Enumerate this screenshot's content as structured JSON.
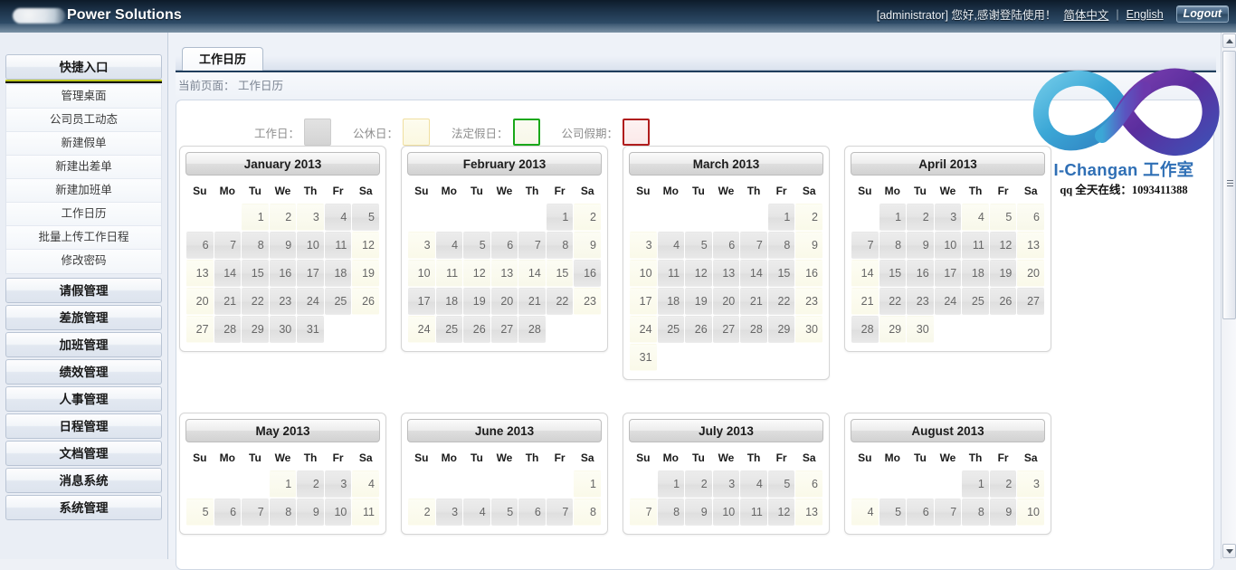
{
  "header": {
    "brand": "Power Solutions",
    "greeting": "[administrator] 您好,感谢登陆使用！",
    "lang_zh": "简体中文",
    "lang_sep": "|",
    "lang_en": "English",
    "logout": "Logout"
  },
  "sidebar": {
    "quick_title": "快捷入口",
    "quick_items": [
      {
        "label": "管理桌面"
      },
      {
        "label": "公司员工动态"
      },
      {
        "label": "新建假单"
      },
      {
        "label": "新建出差单"
      },
      {
        "label": "新建加班单"
      },
      {
        "label": "工作日历"
      },
      {
        "label": "批量上传工作日程"
      },
      {
        "label": "修改密码"
      }
    ],
    "sections": [
      {
        "label": "请假管理"
      },
      {
        "label": "差旅管理"
      },
      {
        "label": "加班管理"
      },
      {
        "label": "绩效管理"
      },
      {
        "label": "人事管理"
      },
      {
        "label": "日程管理"
      },
      {
        "label": "文档管理"
      },
      {
        "label": "消息系统"
      },
      {
        "label": "系统管理"
      }
    ]
  },
  "main": {
    "tab_label": "工作日历",
    "breadcrumb": "当前页面： 工作日历"
  },
  "legend": [
    {
      "label": "工作日：",
      "type": "work",
      "color": "#d4d4d4"
    },
    {
      "label": "公休日：",
      "type": "rest",
      "color": "#fbf8e0"
    },
    {
      "label": "法定假日：",
      "type": "legal",
      "color": "#1aa81a"
    },
    {
      "label": "公司假期：",
      "type": "comp",
      "color": "#b01d1d"
    }
  ],
  "watermark": {
    "title": "I-Changan 工作室",
    "subtitle": "qq 全天在线：1093411388"
  },
  "calendar": {
    "weekdays": [
      "Su",
      "Mo",
      "Tu",
      "We",
      "Th",
      "Fr",
      "Sa"
    ],
    "months": [
      {
        "title": "January 2013",
        "lead_blank": 2,
        "days": [
          {
            "n": 1,
            "t": "legal"
          },
          {
            "n": 2,
            "t": "legal"
          },
          {
            "n": 3,
            "t": "legal"
          },
          {
            "n": 4,
            "t": "work"
          },
          {
            "n": 5,
            "t": "work"
          },
          {
            "n": 6,
            "t": "work"
          },
          {
            "n": 7,
            "t": "work"
          },
          {
            "n": 8,
            "t": "work"
          },
          {
            "n": 9,
            "t": "work"
          },
          {
            "n": 10,
            "t": "work"
          },
          {
            "n": 11,
            "t": "work"
          },
          {
            "n": 12,
            "t": "rest"
          },
          {
            "n": 13,
            "t": "rest"
          },
          {
            "n": 14,
            "t": "work"
          },
          {
            "n": 15,
            "t": "work"
          },
          {
            "n": 16,
            "t": "work"
          },
          {
            "n": 17,
            "t": "work"
          },
          {
            "n": 18,
            "t": "work"
          },
          {
            "n": 19,
            "t": "rest"
          },
          {
            "n": 20,
            "t": "rest"
          },
          {
            "n": 21,
            "t": "work"
          },
          {
            "n": 22,
            "t": "work"
          },
          {
            "n": 23,
            "t": "work"
          },
          {
            "n": 24,
            "t": "work"
          },
          {
            "n": 25,
            "t": "work"
          },
          {
            "n": 26,
            "t": "rest"
          },
          {
            "n": 27,
            "t": "rest"
          },
          {
            "n": 28,
            "t": "work"
          },
          {
            "n": 29,
            "t": "work"
          },
          {
            "n": 30,
            "t": "work"
          },
          {
            "n": 31,
            "t": "work"
          }
        ]
      },
      {
        "title": "February 2013",
        "lead_blank": 5,
        "days": [
          {
            "n": 1,
            "t": "work"
          },
          {
            "n": 2,
            "t": "rest"
          },
          {
            "n": 3,
            "t": "rest"
          },
          {
            "n": 4,
            "t": "work"
          },
          {
            "n": 5,
            "t": "work"
          },
          {
            "n": 6,
            "t": "work"
          },
          {
            "n": 7,
            "t": "work"
          },
          {
            "n": 8,
            "t": "work"
          },
          {
            "n": 9,
            "t": "legal"
          },
          {
            "n": 10,
            "t": "legal"
          },
          {
            "n": 11,
            "t": "legal"
          },
          {
            "n": 12,
            "t": "legal"
          },
          {
            "n": 13,
            "t": "legal"
          },
          {
            "n": 14,
            "t": "legal"
          },
          {
            "n": 15,
            "t": "legal"
          },
          {
            "n": 16,
            "t": "work"
          },
          {
            "n": 17,
            "t": "work"
          },
          {
            "n": 18,
            "t": "work"
          },
          {
            "n": 19,
            "t": "work"
          },
          {
            "n": 20,
            "t": "work"
          },
          {
            "n": 21,
            "t": "work"
          },
          {
            "n": 22,
            "t": "work"
          },
          {
            "n": 23,
            "t": "rest"
          },
          {
            "n": 24,
            "t": "rest"
          },
          {
            "n": 25,
            "t": "work"
          },
          {
            "n": 26,
            "t": "work"
          },
          {
            "n": 27,
            "t": "work"
          },
          {
            "n": 28,
            "t": "work"
          }
        ]
      },
      {
        "title": "March 2013",
        "lead_blank": 5,
        "days": [
          {
            "n": 1,
            "t": "work"
          },
          {
            "n": 2,
            "t": "rest"
          },
          {
            "n": 3,
            "t": "rest"
          },
          {
            "n": 4,
            "t": "work"
          },
          {
            "n": 5,
            "t": "work"
          },
          {
            "n": 6,
            "t": "work"
          },
          {
            "n": 7,
            "t": "work"
          },
          {
            "n": 8,
            "t": "work"
          },
          {
            "n": 9,
            "t": "rest"
          },
          {
            "n": 10,
            "t": "rest"
          },
          {
            "n": 11,
            "t": "work"
          },
          {
            "n": 12,
            "t": "work"
          },
          {
            "n": 13,
            "t": "work"
          },
          {
            "n": 14,
            "t": "work"
          },
          {
            "n": 15,
            "t": "work"
          },
          {
            "n": 16,
            "t": "rest"
          },
          {
            "n": 17,
            "t": "rest"
          },
          {
            "n": 18,
            "t": "work"
          },
          {
            "n": 19,
            "t": "work"
          },
          {
            "n": 20,
            "t": "work"
          },
          {
            "n": 21,
            "t": "work"
          },
          {
            "n": 22,
            "t": "work"
          },
          {
            "n": 23,
            "t": "rest"
          },
          {
            "n": 24,
            "t": "rest"
          },
          {
            "n": 25,
            "t": "work"
          },
          {
            "n": 26,
            "t": "work"
          },
          {
            "n": 27,
            "t": "work"
          },
          {
            "n": 28,
            "t": "work"
          },
          {
            "n": 29,
            "t": "work"
          },
          {
            "n": 30,
            "t": "rest"
          },
          {
            "n": 31,
            "t": "rest"
          }
        ]
      },
      {
        "title": "April 2013",
        "lead_blank": 1,
        "days": [
          {
            "n": 1,
            "t": "work"
          },
          {
            "n": 2,
            "t": "work"
          },
          {
            "n": 3,
            "t": "work"
          },
          {
            "n": 4,
            "t": "legal"
          },
          {
            "n": 5,
            "t": "legal"
          },
          {
            "n": 6,
            "t": "legal"
          },
          {
            "n": 7,
            "t": "work"
          },
          {
            "n": 8,
            "t": "work"
          },
          {
            "n": 9,
            "t": "work"
          },
          {
            "n": 10,
            "t": "work"
          },
          {
            "n": 11,
            "t": "work"
          },
          {
            "n": 12,
            "t": "work"
          },
          {
            "n": 13,
            "t": "rest"
          },
          {
            "n": 14,
            "t": "rest"
          },
          {
            "n": 15,
            "t": "work"
          },
          {
            "n": 16,
            "t": "work"
          },
          {
            "n": 17,
            "t": "work"
          },
          {
            "n": 18,
            "t": "work"
          },
          {
            "n": 19,
            "t": "work"
          },
          {
            "n": 20,
            "t": "rest"
          },
          {
            "n": 21,
            "t": "rest"
          },
          {
            "n": 22,
            "t": "work"
          },
          {
            "n": 23,
            "t": "work"
          },
          {
            "n": 24,
            "t": "work"
          },
          {
            "n": 25,
            "t": "work"
          },
          {
            "n": 26,
            "t": "work"
          },
          {
            "n": 27,
            "t": "work"
          },
          {
            "n": 28,
            "t": "work"
          },
          {
            "n": 29,
            "t": "legal"
          },
          {
            "n": 30,
            "t": "legal"
          }
        ]
      },
      {
        "title": "May 2013",
        "lead_blank": 3,
        "days": [
          {
            "n": 1,
            "t": "legal"
          },
          {
            "n": 2,
            "t": "work"
          },
          {
            "n": 3,
            "t": "work"
          },
          {
            "n": 4,
            "t": "rest"
          },
          {
            "n": 5,
            "t": "rest"
          },
          {
            "n": 6,
            "t": "work"
          },
          {
            "n": 7,
            "t": "work"
          },
          {
            "n": 8,
            "t": "work"
          },
          {
            "n": 9,
            "t": "work"
          },
          {
            "n": 10,
            "t": "work"
          },
          {
            "n": 11,
            "t": "rest"
          }
        ]
      },
      {
        "title": "June 2013",
        "lead_blank": 6,
        "days": [
          {
            "n": 1,
            "t": "rest"
          },
          {
            "n": 2,
            "t": "rest"
          },
          {
            "n": 3,
            "t": "work"
          },
          {
            "n": 4,
            "t": "work"
          },
          {
            "n": 5,
            "t": "work"
          },
          {
            "n": 6,
            "t": "work"
          },
          {
            "n": 7,
            "t": "work"
          },
          {
            "n": 8,
            "t": "rest"
          }
        ]
      },
      {
        "title": "July 2013",
        "lead_blank": 1,
        "days": [
          {
            "n": 1,
            "t": "work"
          },
          {
            "n": 2,
            "t": "work"
          },
          {
            "n": 3,
            "t": "work"
          },
          {
            "n": 4,
            "t": "work"
          },
          {
            "n": 5,
            "t": "work"
          },
          {
            "n": 6,
            "t": "rest"
          },
          {
            "n": 7,
            "t": "rest"
          },
          {
            "n": 8,
            "t": "work"
          },
          {
            "n": 9,
            "t": "work"
          },
          {
            "n": 10,
            "t": "work"
          },
          {
            "n": 11,
            "t": "work"
          },
          {
            "n": 12,
            "t": "work"
          },
          {
            "n": 13,
            "t": "rest"
          }
        ]
      },
      {
        "title": "August 2013",
        "lead_blank": 4,
        "days": [
          {
            "n": 1,
            "t": "work"
          },
          {
            "n": 2,
            "t": "work"
          },
          {
            "n": 3,
            "t": "rest"
          },
          {
            "n": 4,
            "t": "rest"
          },
          {
            "n": 5,
            "t": "work"
          },
          {
            "n": 6,
            "t": "work"
          },
          {
            "n": 7,
            "t": "work"
          },
          {
            "n": 8,
            "t": "work"
          },
          {
            "n": 9,
            "t": "work"
          },
          {
            "n": 10,
            "t": "rest"
          }
        ]
      }
    ]
  }
}
